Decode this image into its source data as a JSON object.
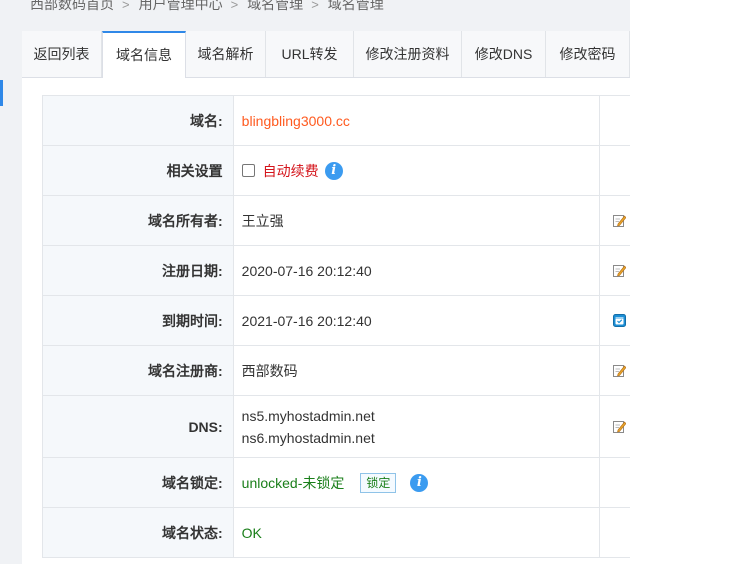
{
  "breadcrumb": {
    "items": [
      "西部数码首页",
      "用户管理中心",
      "域名管理",
      "域名管理"
    ],
    "separator": ">"
  },
  "tabs": [
    {
      "label": "返回列表",
      "active": false
    },
    {
      "label": "域名信息",
      "active": true
    },
    {
      "label": "域名解析",
      "active": false
    },
    {
      "label": "URL转发",
      "active": false
    },
    {
      "label": "修改注册资料",
      "active": false
    },
    {
      "label": "修改DNS",
      "active": false
    },
    {
      "label": "修改密码",
      "active": false
    }
  ],
  "info": {
    "domain": {
      "label": "域名:",
      "value": "blingbling3000.cc"
    },
    "settings": {
      "label": "相关设置",
      "auto_renew_label": "自动续费",
      "auto_renew_checked": false
    },
    "owner": {
      "label": "域名所有者:",
      "value": "王立强"
    },
    "registered": {
      "label": "注册日期:",
      "value": "2020-07-16 20:12:40"
    },
    "expires": {
      "label": "到期时间:",
      "value": "2021-07-16 20:12:40"
    },
    "registrar": {
      "label": "域名注册商:",
      "value": "西部数码"
    },
    "dns": {
      "label": "DNS:",
      "values": [
        "ns5.myhostadmin.net",
        "ns6.myhostadmin.net"
      ]
    },
    "lock": {
      "label": "域名锁定:",
      "value": "unlocked-未锁定",
      "button_label": "锁定"
    },
    "status": {
      "label": "域名状态:",
      "value": "OK"
    }
  },
  "icons": {
    "info": "info-icon",
    "edit": "edit-icon",
    "renew": "renew-icon"
  },
  "colors": {
    "accent": "#2f88e8",
    "domain_text": "#ff5a1f",
    "auto_renew_text": "#d4131a",
    "ok_text": "#1a7f1a",
    "info_icon": "#3b9bf0"
  }
}
